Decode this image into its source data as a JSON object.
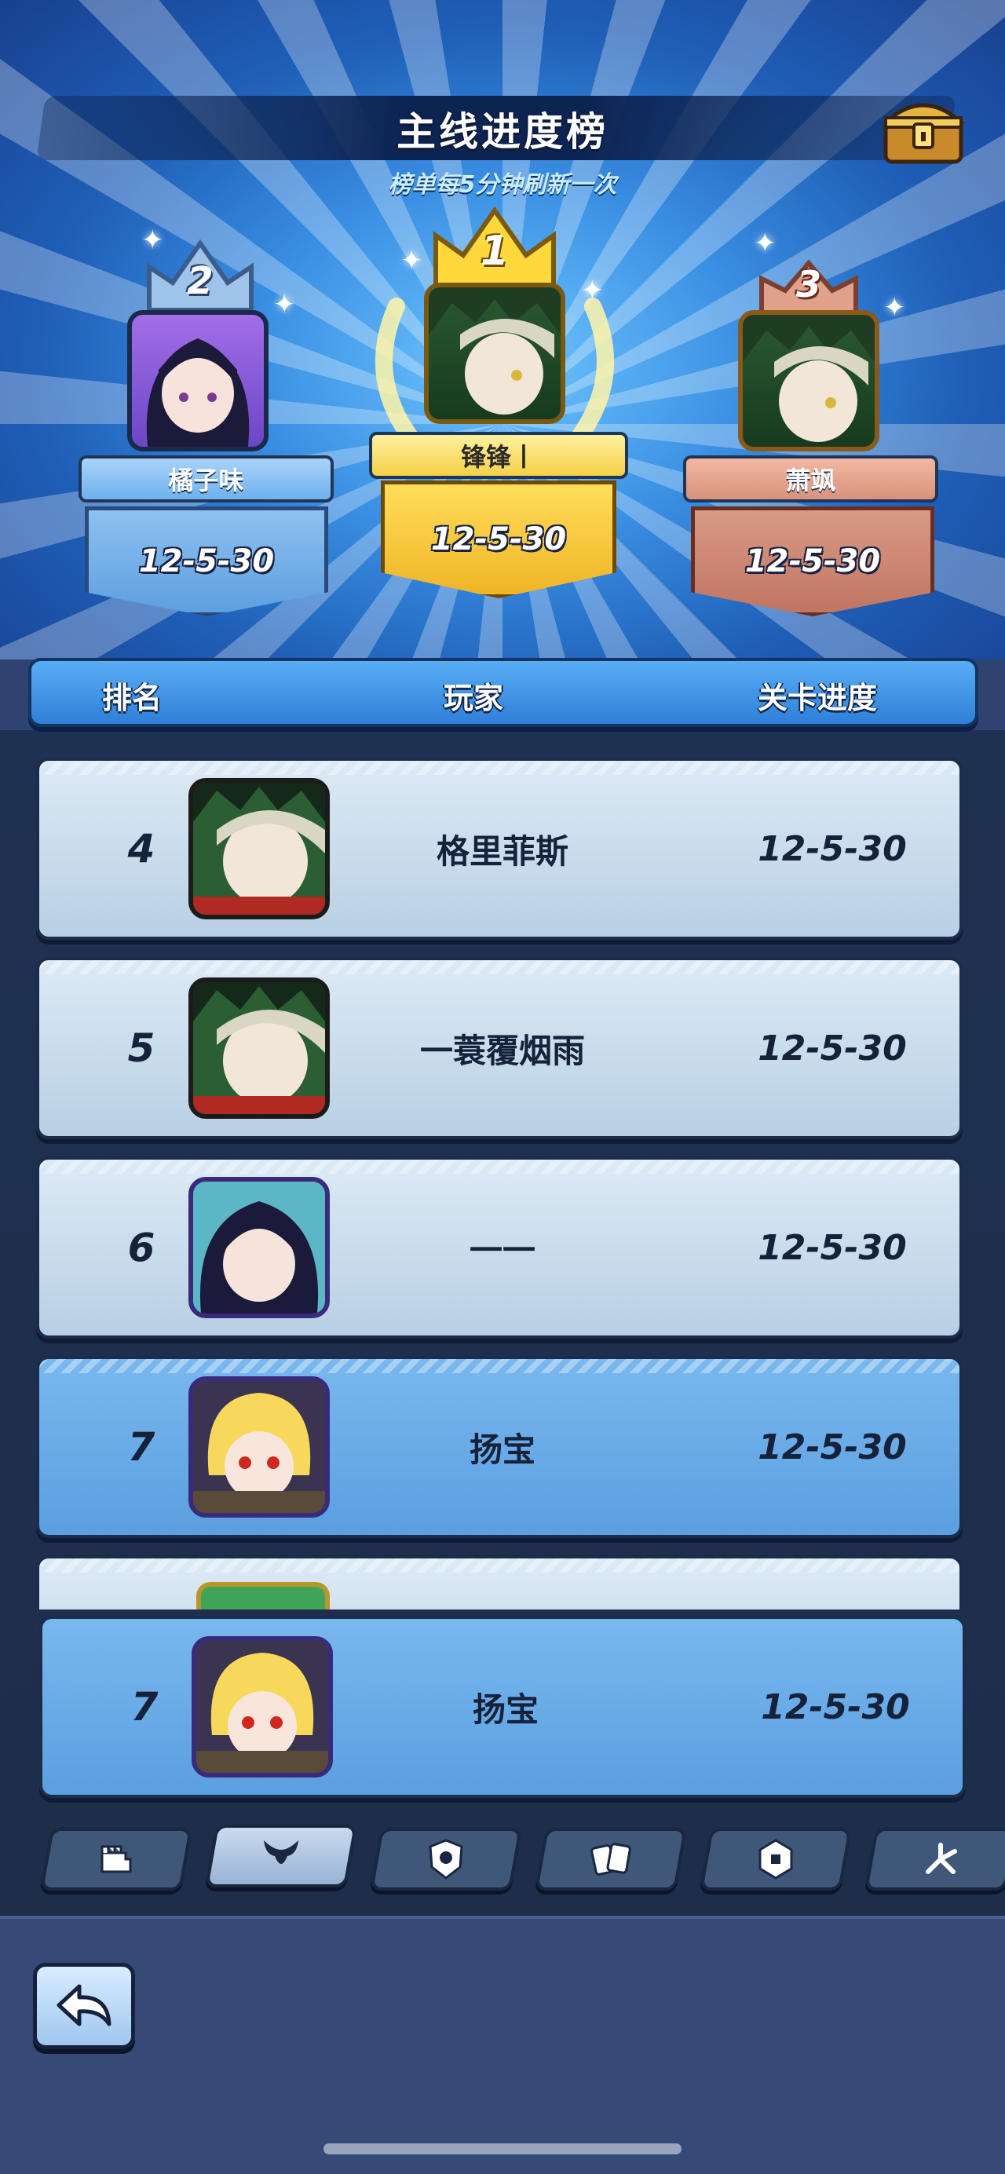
{
  "header": {
    "title": "主线进度榜",
    "subtitle": "榜单每5分钟刷新一次",
    "chest_icon": "treasure-chest-icon"
  },
  "podium": [
    {
      "rank": "1",
      "name": "锋锋丨",
      "progress": "12-5-30",
      "color": "#f4cf46"
    },
    {
      "rank": "2",
      "name": "橘子味",
      "progress": "12-5-30",
      "color": "#7cb6ef"
    },
    {
      "rank": "3",
      "name": "萧飒",
      "progress": "12-5-30",
      "color": "#d99582"
    }
  ],
  "table": {
    "columns": [
      "排名",
      "玩家",
      "关卡进度"
    ],
    "rows": [
      {
        "rank": "4",
        "name": "格里菲斯",
        "progress": "12-5-30"
      },
      {
        "rank": "5",
        "name": "一蓑覆烟雨",
        "progress": "12-5-30"
      },
      {
        "rank": "6",
        "name": "一一",
        "progress": "12-5-30"
      },
      {
        "rank": "7",
        "name": "扬宝",
        "progress": "12-5-30"
      }
    ]
  },
  "self": {
    "rank": "7",
    "name": "扬宝",
    "progress": "12-5-30"
  },
  "tabs": [
    {
      "icon": "fist-icon",
      "active": false
    },
    {
      "icon": "horned-mask-icon",
      "active": true
    },
    {
      "icon": "shield-badge-icon",
      "active": false
    },
    {
      "icon": "cards-icon",
      "active": false
    },
    {
      "icon": "card-icon",
      "active": false
    },
    {
      "icon": "branch-icon",
      "active": false
    }
  ],
  "footer": {
    "back_icon": "back-arrow-icon"
  }
}
